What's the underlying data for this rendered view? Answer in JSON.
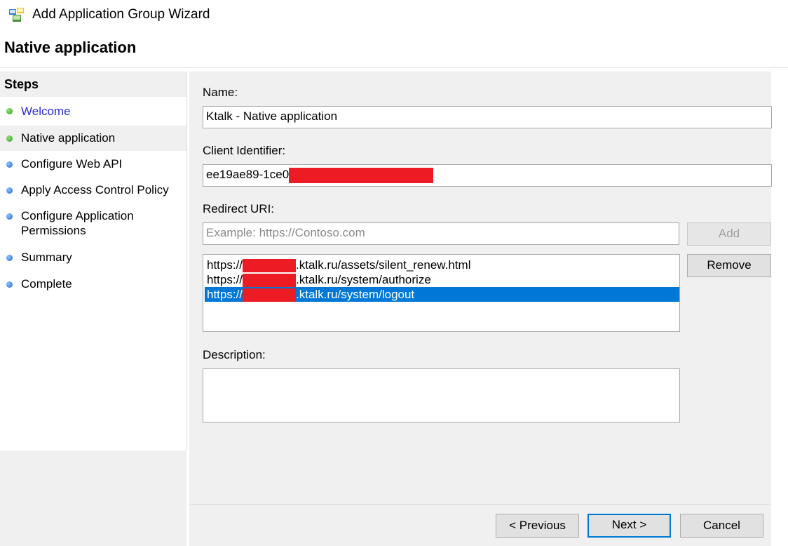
{
  "window": {
    "title": "Add Application Group Wizard",
    "icon": "application-group-icon"
  },
  "page": {
    "heading": "Native application"
  },
  "steps": {
    "title": "Steps",
    "items": [
      {
        "label": "Welcome",
        "status": "done"
      },
      {
        "label": "Native application",
        "status": "current"
      },
      {
        "label": "Configure Web API",
        "status": "pending"
      },
      {
        "label": "Apply Access Control Policy",
        "status": "pending"
      },
      {
        "label": "Configure Application Permissions",
        "status": "pending"
      },
      {
        "label": "Summary",
        "status": "pending"
      },
      {
        "label": "Complete",
        "status": "pending"
      }
    ]
  },
  "form": {
    "name": {
      "label": "Name:",
      "value": "Ktalk - Native application"
    },
    "client_id": {
      "label": "Client Identifier:",
      "value_visible": "ee19ae89-1ce0"
    },
    "redirect": {
      "label": "Redirect URI:",
      "placeholder": "Example: https://Contoso.com",
      "add_label": "Add",
      "remove_label": "Remove",
      "uris": [
        {
          "prefix": "https://",
          "suffix": ".ktalk.ru/assets/silent_renew.html",
          "selected": false
        },
        {
          "prefix": "https://",
          "suffix": ".ktalk.ru/system/authorize",
          "selected": false
        },
        {
          "prefix": "https://",
          "suffix": ".ktalk.ru/system/logout",
          "selected": true
        }
      ]
    },
    "description": {
      "label": "Description:",
      "value": ""
    }
  },
  "footer": {
    "previous_label": "< Previous",
    "next_label": "Next >",
    "cancel_label": "Cancel"
  },
  "colors": {
    "selection": "#0078d7",
    "redaction": "#ed1c24",
    "link": "#2b2bd6",
    "done_dot": "#2c9a1e",
    "pending_dot": "#1d62d4"
  }
}
